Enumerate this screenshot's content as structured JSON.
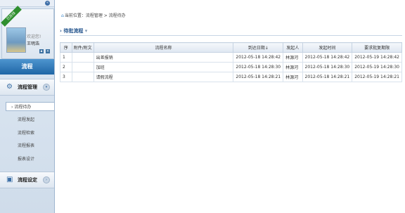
{
  "sidebar": {
    "collapse_icon": "double-chevron-left-icon",
    "ribbon": "已在线",
    "welcome": "欢迎您!",
    "username": "王明浩",
    "nav_band": "流程",
    "section1": {
      "title": "流程管理",
      "icon": "gear-icon"
    },
    "menu": [
      {
        "label": "流程待办",
        "active": true
      },
      {
        "label": "流程发起",
        "active": false
      },
      {
        "label": "流程检索",
        "active": false
      },
      {
        "label": "流程报表",
        "active": false
      },
      {
        "label": "报表设计",
        "active": false
      }
    ],
    "section2": {
      "title": "流程设定",
      "icon": "settings-icon"
    }
  },
  "main": {
    "breadcrumb": "当前位置：流程管理 > 流程待办",
    "section_title": "待批流程",
    "table": {
      "headers": [
        "序",
        "附件/附文",
        "流程名称",
        "到达日期↓",
        "发起人",
        "发起时间",
        "要求批复期限"
      ],
      "rows": [
        {
          "seq": "1",
          "att": "",
          "name": "出差报销",
          "arrive": "2012-05-18 14:28:42",
          "user": "林源河",
          "send": "2012-05-18 14:28:42",
          "req": "2012-05-19 14:28:42"
        },
        {
          "seq": "2",
          "att": "",
          "name": "加班",
          "arrive": "2012-05-18 14:28:30",
          "user": "林源河",
          "send": "2012-05-18 14:28:30",
          "req": "2012-05-19 14:28:30"
        },
        {
          "seq": "3",
          "att": "",
          "name": "请假流程",
          "arrive": "2012-05-18 14:28:21",
          "user": "林源河",
          "send": "2012-05-18 14:28:21",
          "req": "2012-05-19 14:28:21"
        }
      ]
    }
  }
}
